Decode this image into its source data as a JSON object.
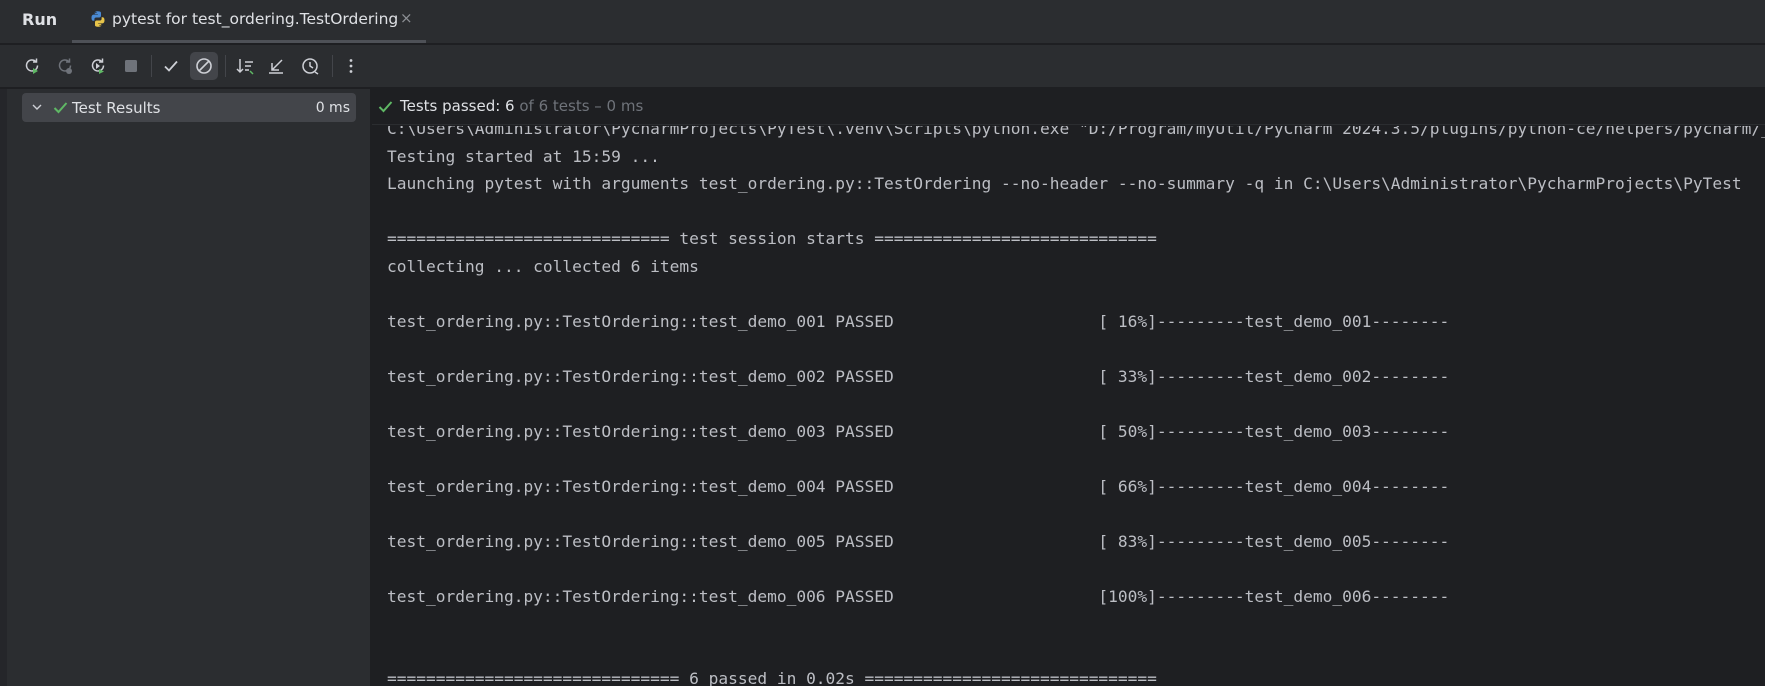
{
  "tabbar": {
    "run_label": "Run",
    "tab_title": "pytest for test_ordering.TestOrdering",
    "tab_close": "×"
  },
  "toolbar": {
    "buttons": [
      {
        "icon": "rerun-icon"
      },
      {
        "icon": "rerun-failed-icon"
      },
      {
        "icon": "toggle-auto-test-icon"
      },
      {
        "icon": "stop-icon"
      },
      {
        "icon": "show-passed-icon"
      },
      {
        "icon": "show-ignored-icon",
        "active": true
      },
      {
        "icon": "sort-alphabetically-icon"
      },
      {
        "icon": "sort-by-duration-icon"
      },
      {
        "icon": "test-history-icon"
      },
      {
        "icon": "more-options-icon"
      }
    ]
  },
  "tree": {
    "root_label": "Test Results",
    "root_duration": "0 ms"
  },
  "status": {
    "passed_label": "Tests passed: 6",
    "passed_detail": " of 6 tests – 0 ms"
  },
  "console": {
    "lines": [
      "C:\\Users\\Administrator\\PycharmProjects\\PyTest\\.venv\\Scripts\\python.exe \"D:/Program/myUtil/PyCharm 2024.3.5/plugins/python-ce/helpers/pycharm/_jb_pytest_runner.py\"",
      "Testing started at 15:59 ...",
      "Launching pytest with arguments test_ordering.py::TestOrdering --no-header --no-summary -q in C:\\Users\\Administrator\\PycharmProjects\\PyTest",
      "",
      "============================= test session starts =============================",
      "collecting ... collected 6 items",
      "",
      "test_ordering.py::TestOrdering::test_demo_001 PASSED                     [ 16%]---------test_demo_001--------",
      "",
      "test_ordering.py::TestOrdering::test_demo_002 PASSED                     [ 33%]---------test_demo_002--------",
      "",
      "test_ordering.py::TestOrdering::test_demo_003 PASSED                     [ 50%]---------test_demo_003--------",
      "",
      "test_ordering.py::TestOrdering::test_demo_004 PASSED                     [ 66%]---------test_demo_004--------",
      "",
      "test_ordering.py::TestOrdering::test_demo_005 PASSED                     [ 83%]---------test_demo_005--------",
      "",
      "test_ordering.py::TestOrdering::test_demo_006 PASSED                     [100%]---------test_demo_006--------",
      "",
      "",
      "============================== 6 passed in 0.02s =============================="
    ]
  },
  "colors": {
    "accent_green": "#5fb865",
    "background": "#1e1f22",
    "panel": "#2b2d30"
  }
}
